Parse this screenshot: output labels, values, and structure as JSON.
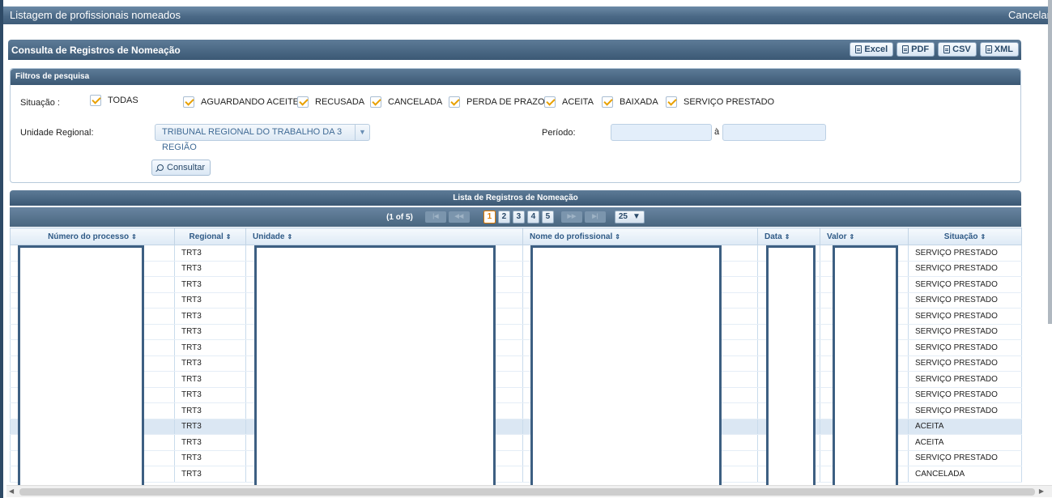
{
  "window": {
    "title": "Listagem de profissionais nomeados",
    "cancel_label": "Cancelar"
  },
  "panel": {
    "title": "Consulta de Registros de Nomeação",
    "exports": [
      "Excel",
      "PDF",
      "CSV",
      "XML"
    ]
  },
  "filters": {
    "title": "Filtros de pesquisa",
    "situacao_label": "Situação :",
    "situacoes": [
      "TODAS",
      "AGUARDANDO ACEITE",
      "RECUSADA",
      "CANCELADA",
      "PERDA DE PRAZO",
      "ACEITA",
      "BAIXADA",
      "SERVIÇO PRESTADO"
    ],
    "unidade_label": "Unidade Regional:",
    "unidade_value": "TRIBUNAL REGIONAL DO TRABALHO DA 3 REGIÃO",
    "periodo_label": "Período:",
    "periodo_sep": "à",
    "consultar_label": "Consultar"
  },
  "list": {
    "title": "Lista de Registros de Nomeação",
    "pager": {
      "info": "(1 of 5)",
      "pages": [
        "1",
        "2",
        "3",
        "4",
        "5"
      ],
      "current": "1",
      "page_size": "25"
    },
    "columns": [
      "Número do processo",
      "Regional",
      "Unidade",
      "Nome do profissional",
      "Data",
      "Valor",
      "Situação"
    ],
    "rows": [
      {
        "regional": "TRT3",
        "situacao": "SERVIÇO PRESTADO"
      },
      {
        "regional": "TRT3",
        "situacao": "SERVIÇO PRESTADO"
      },
      {
        "regional": "TRT3",
        "situacao": "SERVIÇO PRESTADO"
      },
      {
        "regional": "TRT3",
        "situacao": "SERVIÇO PRESTADO"
      },
      {
        "regional": "TRT3",
        "situacao": "SERVIÇO PRESTADO"
      },
      {
        "regional": "TRT3",
        "situacao": "SERVIÇO PRESTADO"
      },
      {
        "regional": "TRT3",
        "situacao": "SERVIÇO PRESTADO"
      },
      {
        "regional": "TRT3",
        "situacao": "SERVIÇO PRESTADO"
      },
      {
        "regional": "TRT3",
        "situacao": "SERVIÇO PRESTADO"
      },
      {
        "regional": "TRT3",
        "situacao": "SERVIÇO PRESTADO"
      },
      {
        "regional": "TRT3",
        "situacao": "SERVIÇO PRESTADO"
      },
      {
        "regional": "TRT3",
        "situacao": "ACEITA"
      },
      {
        "regional": "TRT3",
        "situacao": "ACEITA"
      },
      {
        "regional": "TRT3",
        "situacao": "SERVIÇO PRESTADO"
      },
      {
        "regional": "TRT3",
        "situacao": "CANCELADA"
      }
    ],
    "selected_row": 11
  }
}
